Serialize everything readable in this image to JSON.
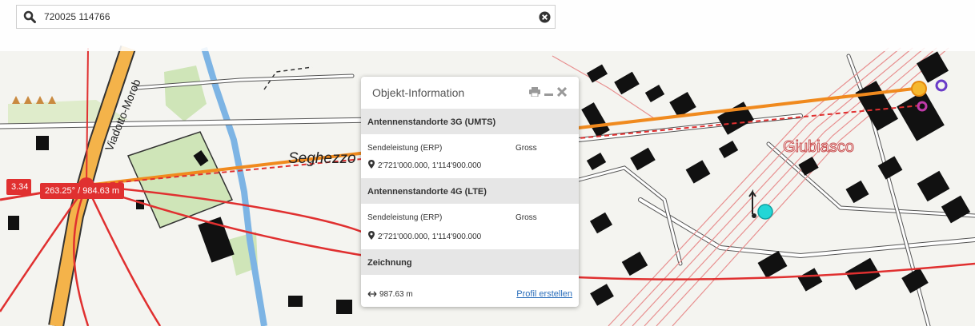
{
  "search": {
    "value": "720025 114766"
  },
  "map": {
    "place_label_1": "Seghezzo",
    "place_label_2": "Giubiasco",
    "road_label": "Viadotto-Morob",
    "measure_segment": "263.25° / 984.63 m",
    "measure_left": "3.34"
  },
  "popup": {
    "title": "Objekt-Information",
    "sections": [
      {
        "heading": "Antennenstandorte 3G (UMTS)",
        "field": "Sendeleistung (ERP)",
        "value": "Gross",
        "coords": "2'721'000.000, 1'114'900.000"
      },
      {
        "heading": "Antennenstandorte 4G (LTE)",
        "field": "Sendeleistung (ERP)",
        "value": "Gross",
        "coords": "2'721'000.000, 1'114'900.000"
      }
    ],
    "drawing": {
      "heading": "Zeichnung",
      "distance": "987.63 m",
      "profile_link": "Profil erstellen"
    }
  },
  "colors": {
    "measure": "#e03030",
    "orange_line": "#f08a1e",
    "rail": "#e89090"
  }
}
